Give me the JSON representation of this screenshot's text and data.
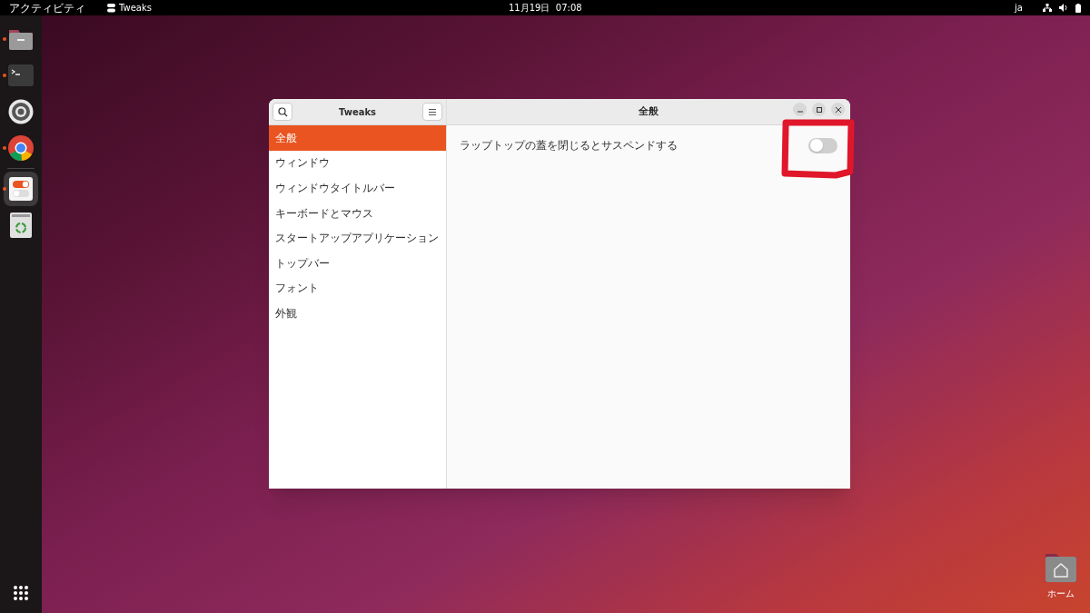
{
  "top_bar": {
    "activities": "アクティビティ",
    "app_name": "Tweaks",
    "clock": "11月19日  07:08",
    "input_method": "ja"
  },
  "dock": [
    {
      "kind": "folder",
      "running": true,
      "selected": false
    },
    {
      "kind": "terminal",
      "running": true,
      "selected": false
    },
    {
      "kind": "settings",
      "running": false,
      "selected": false
    },
    {
      "kind": "browser",
      "running": true,
      "selected": false
    },
    {
      "kind": "tweaks",
      "running": true,
      "selected": true
    },
    {
      "kind": "trash",
      "running": false,
      "selected": false
    }
  ],
  "window": {
    "title": "Tweaks",
    "page_title": "全般",
    "sidebar": {
      "items": [
        {
          "label": "全般",
          "selected": true
        },
        {
          "label": "ウィンドウ",
          "selected": false
        },
        {
          "label": "ウィンドウタイトルバー",
          "selected": false
        },
        {
          "label": "キーボードとマウス",
          "selected": false
        },
        {
          "label": "スタートアップアプリケーション",
          "selected": false
        },
        {
          "label": "トップバー",
          "selected": false
        },
        {
          "label": "フォント",
          "selected": false
        },
        {
          "label": "外観",
          "selected": false
        }
      ]
    },
    "settings": [
      {
        "label": "ラップトップの蓋を閉じるとサスペンドする",
        "on": false
      }
    ]
  },
  "desktop_icons": [
    {
      "label": "ホーム"
    }
  ]
}
